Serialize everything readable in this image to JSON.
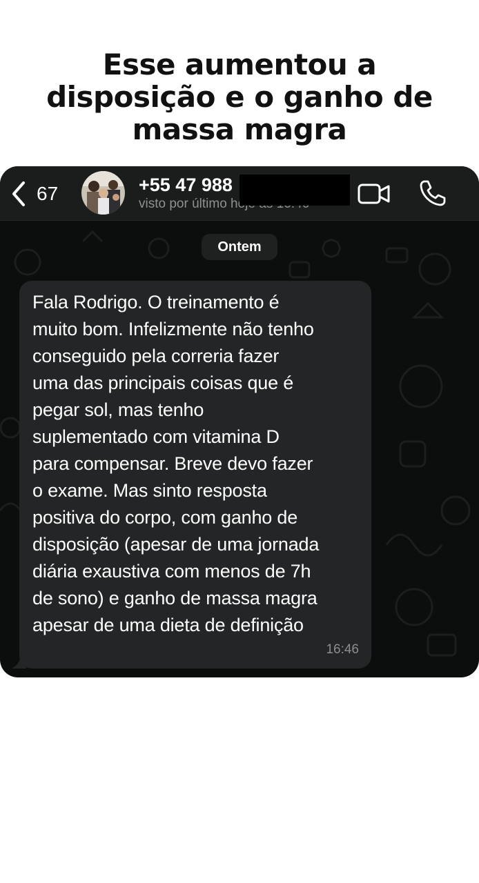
{
  "headline": {
    "line1": "Esse aumentou a",
    "line2": "disposição e o ganho de",
    "line3": "massa magra"
  },
  "chat_header": {
    "back_count": "67",
    "contact_number": "+55 47 988",
    "last_seen": "visto por último hoje às 16:46",
    "icons": [
      "chevron-left-icon",
      "video-camera-icon",
      "phone-icon"
    ]
  },
  "chat": {
    "date_label": "Ontem",
    "message": {
      "text": "Fala Rodrigo. O treinamento é\nmuito bom. Infelizmente não tenho\nconseguido pela correria fazer\numa das principais coisas que é\npegar sol, mas tenho\nsuplementado com vitamina D\npara compensar.  Breve devo fazer\no exame. Mas sinto resposta\npositiva do corpo, com ganho de\ndisposição (apesar de uma jornada\ndiária exaustiva com menos de 7h\nde sono) e ganho de massa magra\napesar de uma dieta de definição",
      "time": "16:46"
    }
  },
  "colors": {
    "page_bg": "#ffffff",
    "headline": "#111111",
    "header_bg": "#1b1d1d",
    "chat_bg": "#0c0d0d",
    "bubble_bg": "#232526",
    "time_text": "#8b8f8e"
  }
}
